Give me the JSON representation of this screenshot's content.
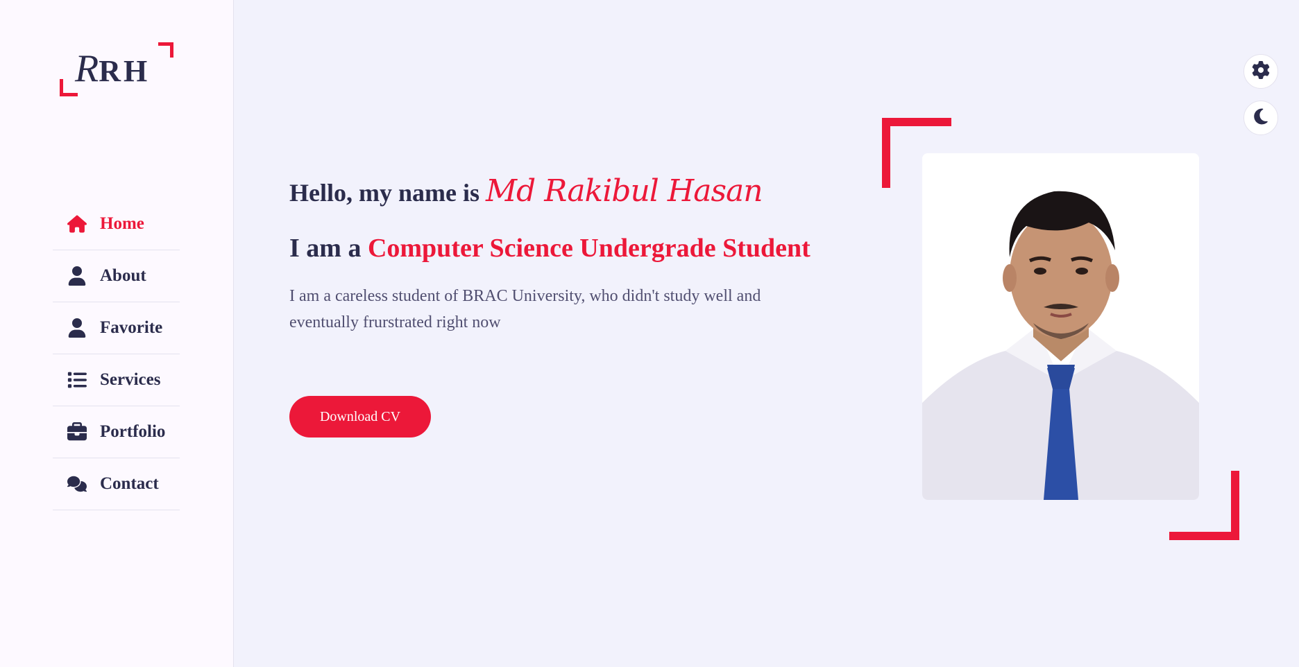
{
  "logo": {
    "text_script": "R",
    "text_rest": "RH"
  },
  "sidebar": {
    "items": [
      {
        "label": "Home",
        "icon": "home-icon",
        "active": true
      },
      {
        "label": "About",
        "icon": "user-icon",
        "active": false
      },
      {
        "label": "Favorite",
        "icon": "user-icon",
        "active": false
      },
      {
        "label": "Services",
        "icon": "list-icon",
        "active": false
      },
      {
        "label": "Portfolio",
        "icon": "briefcase-icon",
        "active": false
      },
      {
        "label": "Contact",
        "icon": "comments-icon",
        "active": false
      }
    ]
  },
  "hero": {
    "greeting": "Hello, my name is ",
    "name": "Md Rakibul Hasan",
    "iam_prefix": "I am a ",
    "role": "Computer Science Undergrade Student",
    "description": "I am a careless student of BRAC University, who didn't study well and eventually frurstrated right now",
    "cv_button": "Download CV"
  },
  "controls": {
    "settings_icon": "gear-icon",
    "theme_icon": "moon-icon"
  },
  "colors": {
    "accent": "#ec1839",
    "text": "#2b2c4c",
    "bg": "#f2f2fc",
    "sidebar_bg": "#fdf9ff"
  }
}
